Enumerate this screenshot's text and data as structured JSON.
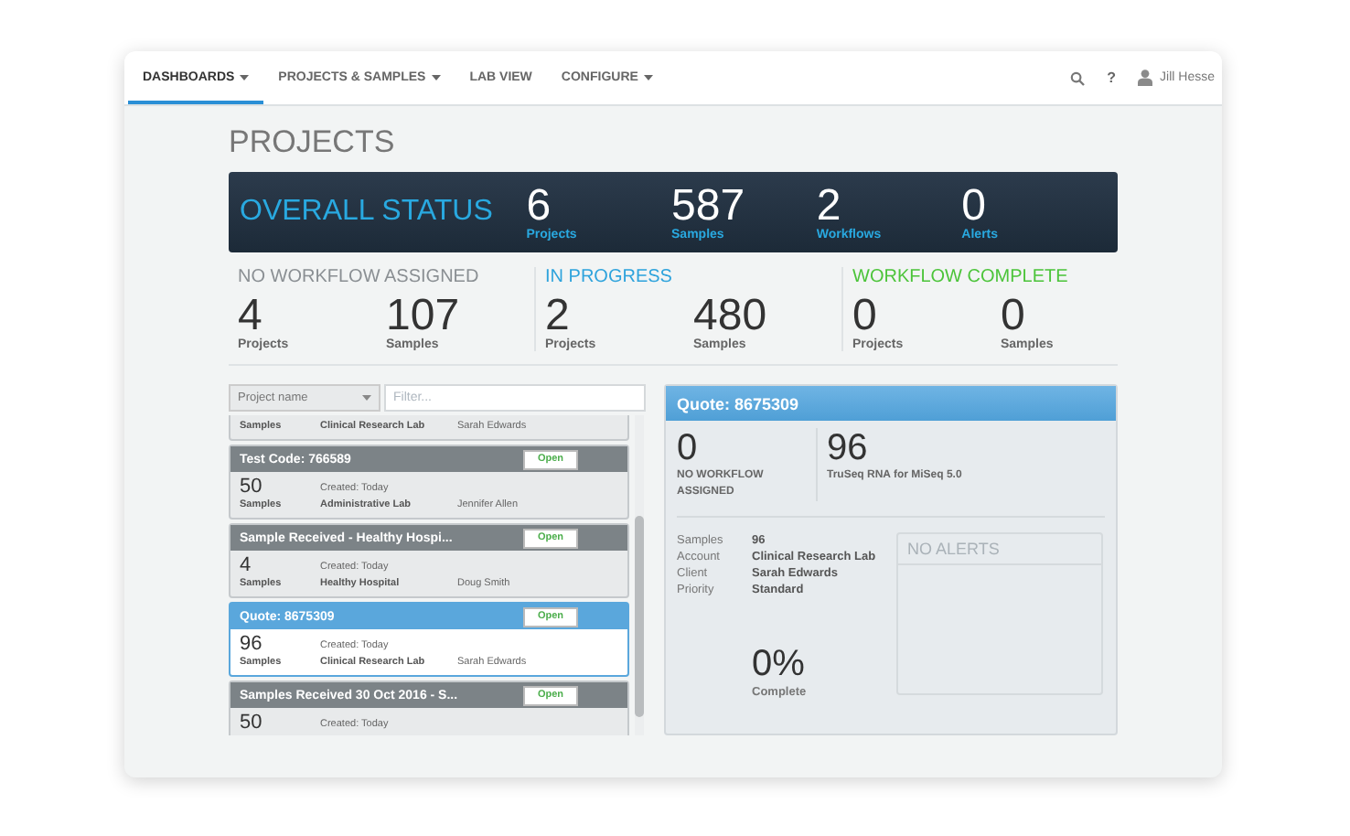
{
  "nav": {
    "tabs": [
      {
        "label": "DASHBOARDS",
        "dropdown": true,
        "selected": true
      },
      {
        "label": "PROJECTS & SAMPLES",
        "dropdown": true,
        "selected": false
      },
      {
        "label": "LAB VIEW",
        "dropdown": false,
        "selected": false
      },
      {
        "label": "CONFIGURE",
        "dropdown": true,
        "selected": false
      }
    ],
    "help": "?",
    "user": "Jill Hesse"
  },
  "page_title": "PROJECTS",
  "overall": {
    "title": "OVERALL STATUS",
    "stats": [
      {
        "value": "6",
        "label": "Projects"
      },
      {
        "value": "587",
        "label": "Samples"
      },
      {
        "value": "2",
        "label": "Workflows"
      },
      {
        "value": "0",
        "label": "Alerts"
      }
    ]
  },
  "groups": [
    {
      "title": "NO WORKFLOW ASSIGNED",
      "color": "#8a8f93",
      "stats": [
        {
          "value": "4",
          "label": "Projects"
        },
        {
          "value": "107",
          "label": "Samples"
        }
      ]
    },
    {
      "title": "IN PROGRESS",
      "color": "#2ea3dc",
      "stats": [
        {
          "value": "2",
          "label": "Projects"
        },
        {
          "value": "480",
          "label": "Samples"
        }
      ]
    },
    {
      "title": "WORKFLOW COMPLETE",
      "color": "#4cc43a",
      "stats": [
        {
          "value": "0",
          "label": "Projects"
        },
        {
          "value": "0",
          "label": "Samples"
        }
      ]
    }
  ],
  "filter": {
    "dropdown": "Project name",
    "placeholder": "Filter..."
  },
  "projects": [
    {
      "samples_label": "Samples",
      "account": "Clinical Research Lab",
      "client": "Sarah Edwards",
      "selected": false
    },
    {
      "title": "Test Code: 766589",
      "button": "Open",
      "count": "50",
      "samples_label": "Samples",
      "created": "Created: Today",
      "account": "Administrative Lab",
      "client": "Jennifer Allen",
      "selected": false
    },
    {
      "title": "Sample Received - Healthy Hospi...",
      "button": "Open",
      "count": "4",
      "samples_label": "Samples",
      "created": "Created: Today",
      "account": "Healthy Hospital",
      "client": "Doug Smith",
      "selected": false
    },
    {
      "title": "Quote: 8675309",
      "button": "Open",
      "count": "96",
      "samples_label": "Samples",
      "created": "Created: Today",
      "account": "Clinical Research Lab",
      "client": "Sarah Edwards",
      "selected": true
    },
    {
      "title": "Samples Received 30 Oct 2016 - S...",
      "button": "Open",
      "count": "50",
      "created": "Created: Today",
      "selected": false
    }
  ],
  "detail": {
    "title": "Quote: 8675309",
    "stats": [
      {
        "value": "0",
        "label": "NO WORKFLOW ASSIGNED"
      },
      {
        "value": "96",
        "label": "TruSeq RNA for MiSeq 5.0"
      }
    ],
    "fields": [
      {
        "label": "Samples",
        "value": "96"
      },
      {
        "label": "Account",
        "value": "Clinical Research Lab"
      },
      {
        "label": "Client",
        "value": "Sarah Edwards"
      },
      {
        "label": "Priority",
        "value": "Standard"
      }
    ],
    "progress": {
      "value": "0%",
      "label": "Complete"
    },
    "alerts": {
      "title": "NO ALERTS"
    }
  }
}
